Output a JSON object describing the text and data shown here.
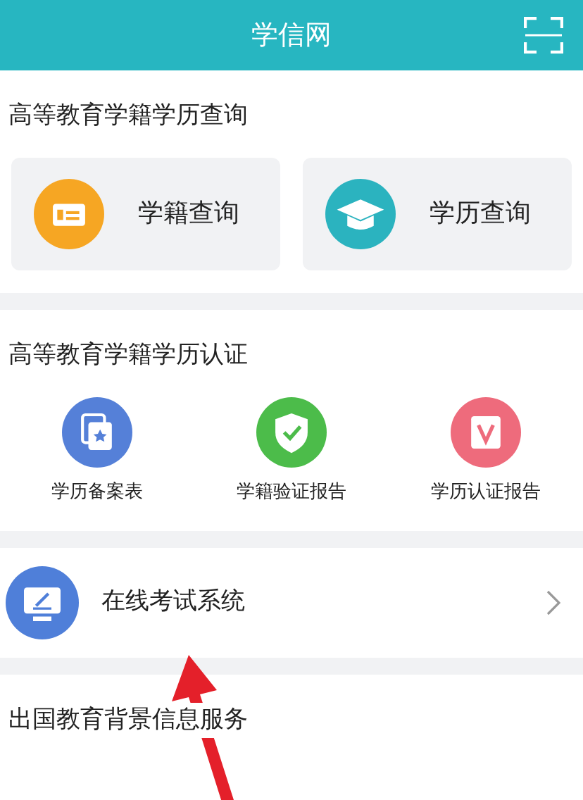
{
  "header": {
    "title": "学信网"
  },
  "query_section": {
    "title": "高等教育学籍学历查询",
    "cards": [
      {
        "kind": "id-card",
        "label": "学籍查询",
        "color": "#f6a623"
      },
      {
        "kind": "cap",
        "label": "学历查询",
        "color": "#2bb3bf"
      }
    ]
  },
  "cert_section": {
    "title": "高等教育学籍学历认证",
    "items": [
      {
        "kind": "doc",
        "label": "学历备案表",
        "color": "#5580d8"
      },
      {
        "kind": "shield",
        "label": "学籍验证报告",
        "color": "#4cbc4a"
      },
      {
        "kind": "verify",
        "label": "学历认证报告",
        "color": "#ee6b7c"
      }
    ]
  },
  "exam_row": {
    "label": "在线考试系统"
  },
  "abroad_section": {
    "title": "出国教育背景信息服务"
  }
}
